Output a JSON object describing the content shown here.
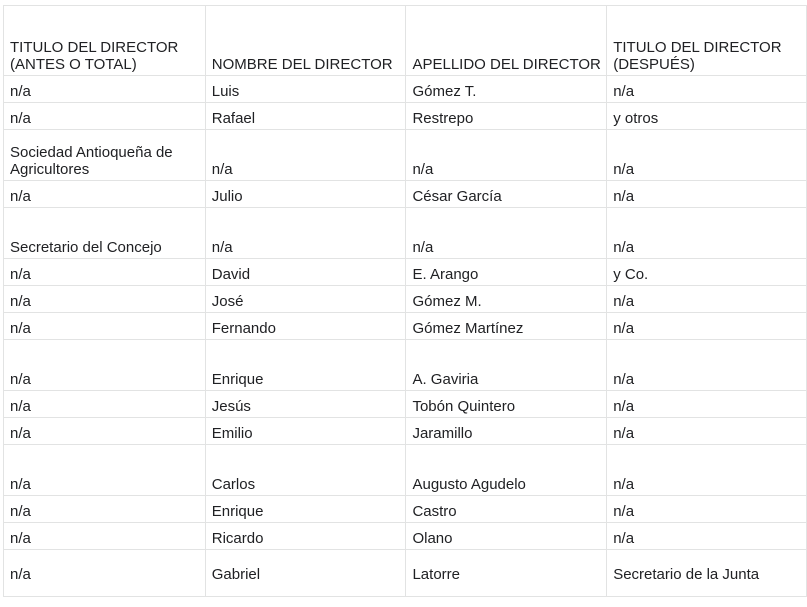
{
  "sheet": {
    "headers": [
      "TITULO DEL DIRECTOR (ANTES O TOTAL)",
      "NOMBRE DEL DIRECTOR",
      "APELLIDO DEL DIRECTOR",
      "TITULO DEL DIRECTOR (DESPUÉS)"
    ],
    "rows": [
      [
        "n/a",
        "Luis",
        "Gómez T.",
        "n/a"
      ],
      [
        "n/a",
        "Rafael",
        "Restrepo",
        "y otros"
      ],
      [
        "Sociedad Antioqueña de Agricultores",
        "n/a",
        "n/a",
        "n/a"
      ],
      [
        "n/a",
        "Julio",
        "César García",
        "n/a"
      ],
      [
        "Secretario del Concejo",
        "n/a",
        "n/a",
        "n/a"
      ],
      [
        "n/a",
        "David",
        "E. Arango",
        "y Co."
      ],
      [
        "n/a",
        "José",
        "Gómez M.",
        "n/a"
      ],
      [
        "n/a",
        "Fernando",
        "Gómez Martínez",
        "n/a"
      ],
      [
        "n/a",
        "Enrique",
        "A. Gaviria",
        "n/a"
      ],
      [
        "n/a",
        "Jesús",
        "Tobón Quintero",
        "n/a"
      ],
      [
        "n/a",
        "Emilio",
        "Jaramillo",
        "n/a"
      ],
      [
        "n/a",
        "Carlos",
        "Augusto Agudelo",
        "n/a"
      ],
      [
        "n/a",
        "Enrique",
        "Castro",
        "n/a"
      ],
      [
        "n/a",
        "Ricardo",
        "Olano",
        "n/a"
      ],
      [
        "n/a",
        "Gabriel",
        "Latorre",
        "Secretario de la Junta"
      ]
    ]
  }
}
